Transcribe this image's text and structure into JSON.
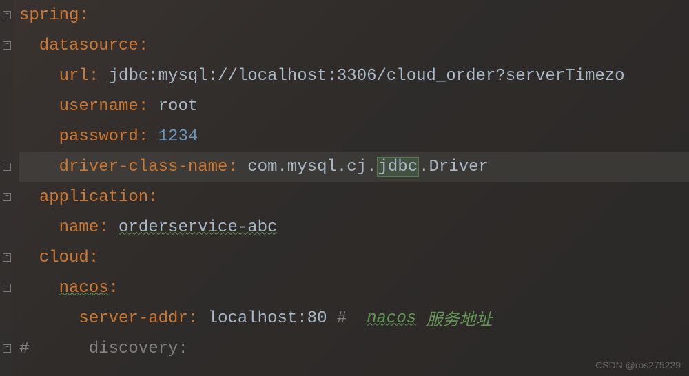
{
  "lines": [
    {
      "fold": "minus",
      "indent": 0,
      "segments": [
        {
          "text": "spring",
          "class": "key"
        },
        {
          "text": ":",
          "class": "colon"
        }
      ],
      "highlighted": false
    },
    {
      "fold": "minus",
      "indent": 1,
      "segments": [
        {
          "text": "datasource",
          "class": "key"
        },
        {
          "text": ":",
          "class": "colon"
        }
      ],
      "highlighted": false
    },
    {
      "fold": "",
      "indent": 2,
      "segments": [
        {
          "text": "url",
          "class": "key"
        },
        {
          "text": ": ",
          "class": "colon"
        },
        {
          "text": "jdbc:mysql://localhost:3306/cloud_order?serverTimezo",
          "class": "value"
        }
      ],
      "highlighted": false
    },
    {
      "fold": "",
      "indent": 2,
      "segments": [
        {
          "text": "username",
          "class": "key"
        },
        {
          "text": ": ",
          "class": "colon"
        },
        {
          "text": "root",
          "class": "value"
        }
      ],
      "highlighted": false
    },
    {
      "fold": "",
      "indent": 2,
      "segments": [
        {
          "text": "password",
          "class": "key"
        },
        {
          "text": ": ",
          "class": "colon"
        },
        {
          "text": "1234",
          "class": "number"
        }
      ],
      "highlighted": false
    },
    {
      "fold": "minus",
      "indent": 2,
      "segments": [
        {
          "text": "driver-class-name",
          "class": "key"
        },
        {
          "text": ": ",
          "class": "colon"
        },
        {
          "text": "com.mysql.cj.",
          "class": "value"
        },
        {
          "text": "jdbc",
          "class": "value selection-highlight"
        },
        {
          "text": ".Driver",
          "class": "value"
        }
      ],
      "highlighted": true
    },
    {
      "fold": "minus",
      "indent": 1,
      "segments": [
        {
          "text": "application",
          "class": "key"
        },
        {
          "text": ":",
          "class": "colon"
        }
      ],
      "highlighted": false
    },
    {
      "fold": "",
      "indent": 2,
      "segments": [
        {
          "text": "name",
          "class": "key"
        },
        {
          "text": ": ",
          "class": "colon"
        },
        {
          "text": "orderservice-abc",
          "class": "value underline-wavy"
        }
      ],
      "highlighted": false
    },
    {
      "fold": "minus",
      "indent": 1,
      "segments": [
        {
          "text": "cloud",
          "class": "key"
        },
        {
          "text": ":",
          "class": "colon"
        }
      ],
      "highlighted": false
    },
    {
      "fold": "minus",
      "indent": 2,
      "segments": [
        {
          "text": "nacos",
          "class": "key underline-wavy"
        },
        {
          "text": ":",
          "class": "colon"
        }
      ],
      "highlighted": false
    },
    {
      "fold": "",
      "indent": 3,
      "segments": [
        {
          "text": "server-addr",
          "class": "key"
        },
        {
          "text": ": ",
          "class": "colon"
        },
        {
          "text": "localhost:80 ",
          "class": "value"
        },
        {
          "text": "#  ",
          "class": "comment-hash"
        },
        {
          "text": "nacos",
          "class": "comment-italic underline-wavy"
        },
        {
          "text": " 服务地址",
          "class": "comment-italic"
        }
      ],
      "highlighted": false
    },
    {
      "fold": "minus",
      "indent": 0,
      "segments": [
        {
          "text": "#      discovery:",
          "class": "comment-hash"
        }
      ],
      "highlighted": false
    }
  ],
  "indent_spaces": "  ",
  "watermark": "CSDN @ros275229"
}
